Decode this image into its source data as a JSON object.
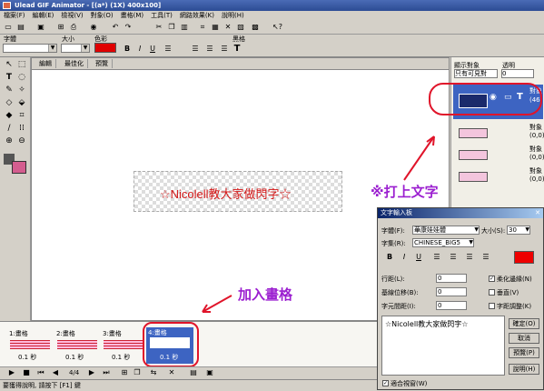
{
  "window": {
    "title": "Ulead GIF Animator - [(a*) (1X) 400x100]"
  },
  "menu": [
    "檔案(F)",
    "編輯(E)",
    "檢視(V)",
    "對象(O)",
    "畫格(M)",
    "工具(T)",
    "網路效果(K)",
    "說明(H)"
  ],
  "attr_bar": {
    "font_label": "字體",
    "size_label": "大小",
    "color_label": "色彩",
    "color_swatch": "#e00000",
    "blackbody_label": "黑格"
  },
  "work_tabs": [
    "編輯",
    "最佳化",
    "預覽"
  ],
  "canvas": {
    "text": "☆Nicolell教大家做閃字☆"
  },
  "object_panel": {
    "display_label": "顯示對象",
    "display_value": "只有可見對",
    "opacity_label": "透明",
    "opacity_value": "0",
    "objects": [
      {
        "name": "對象",
        "info": "(46,"
      },
      {
        "name": "對象",
        "info": "(0,0)"
      },
      {
        "name": "對象",
        "info": "(0,0)"
      },
      {
        "name": "對象",
        "info": "(0,0)"
      }
    ]
  },
  "frames": [
    {
      "label": "1:畫格",
      "time": "0.1 秒"
    },
    {
      "label": "2:畫格",
      "time": "0.1 秒"
    },
    {
      "label": "3:畫格",
      "time": "0.1 秒"
    },
    {
      "label": "4:畫格",
      "time": "0.1 秒"
    }
  ],
  "playbar": {
    "counter": "4/4"
  },
  "status": {
    "text": "要獲得說明, 請按下 [F1] 鍵"
  },
  "dialog": {
    "title": "文字輸入板",
    "font_label": "字體(F):",
    "font_value": "華康娃娃體",
    "size_label": "大小(S):",
    "size_value": "30",
    "charset_label": "字集(R):",
    "charset_value": "CHINESE_BIG5",
    "color": "#ee0000",
    "line_spacing_label": "行距(L):",
    "line_spacing_value": "0",
    "baseline_label": "基線位移(B):",
    "baseline_value": "0",
    "char_spacing_label": "字元間距(I):",
    "char_spacing_value": "0",
    "antialias_label": "柔化邊緣(N)",
    "vertical_label": "垂直(V)",
    "kerning_label": "字距調整(K)",
    "text_value": "☆Nicolell教大家做閃字☆",
    "ok": "確定(O)",
    "cancel": "取消",
    "preview": "預覽(P)",
    "help": "說明(H)",
    "fit_window_label": "適合視窗(W)"
  },
  "annotations": {
    "type_text": "※打上文字",
    "add_frame": "加入畫格",
    "color": "#9b1fd0"
  }
}
